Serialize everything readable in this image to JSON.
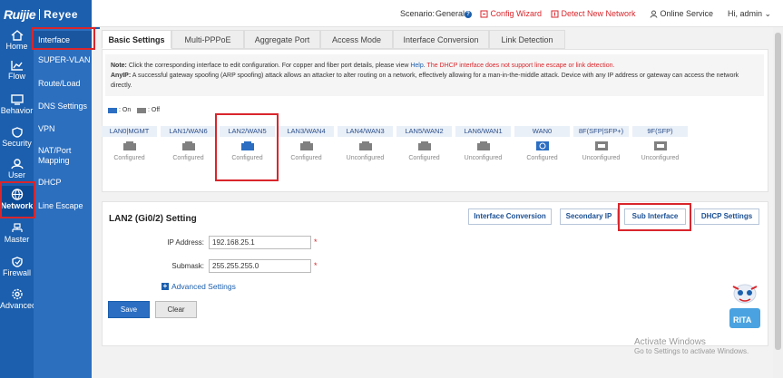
{
  "brand": {
    "logo_part1": "Ruijie",
    "logo_part2": "Reyee"
  },
  "leftnav": [
    {
      "label": "Home",
      "icon": "home-icon"
    },
    {
      "label": "Flow",
      "icon": "chart-icon"
    },
    {
      "label": "Behavior",
      "icon": "monitor-icon"
    },
    {
      "label": "Security",
      "icon": "shield-icon"
    },
    {
      "label": "User",
      "icon": "user-icon"
    },
    {
      "label": "Network",
      "icon": "globe-icon",
      "active": true
    },
    {
      "label": "Master",
      "icon": "master-icon"
    },
    {
      "label": "Firewall",
      "icon": "firewall-icon"
    },
    {
      "label": "Advanced",
      "icon": "gear-icon"
    }
  ],
  "submenu": [
    "Interface",
    "SUPER-VLAN",
    "Route/Load",
    "DNS Settings",
    "VPN",
    "NAT/Port Mapping",
    "DHCP",
    "Line Escape"
  ],
  "topbar": {
    "scenario_label": "Scenario:",
    "scenario_value": "General",
    "help_glyph": "?",
    "config_wizard": "Config Wizard",
    "detect_network": "Detect New Network",
    "online_service": "Online Service",
    "greeting": "Hi, admin",
    "greeting_caret": "⌄"
  },
  "tabs": [
    "Basic Settings",
    "Multi-PPPoE",
    "Aggregate Port",
    "Access Mode",
    "Interface Conversion",
    "Link Detection"
  ],
  "note": {
    "note_label": "Note:",
    "note_text": "Click the corresponding interface to edit configuration. For copper and fiber port details, please view",
    "help_link": "Help",
    "note_end": ".",
    "note_red": "The DHCP interface does not support line escape or link detection.",
    "anyip_label": "AnyIP:",
    "anyip_text": "A successful gateway spoofing (ARP spoofing) attack allows an attacker to alter routing on a network, effectively allowing for a man-in-the-middle attack. Device with any IP address or gateway can access the network directly."
  },
  "legend": {
    "on": ": On",
    "off": ": Off"
  },
  "ports": [
    {
      "name": "LAN0|MGMT",
      "status": "Configured",
      "on": false
    },
    {
      "name": "LAN1/WAN6",
      "status": "Configured",
      "on": false
    },
    {
      "name": "LAN2/WAN5",
      "status": "Configured",
      "on": true
    },
    {
      "name": "LAN3/WAN4",
      "status": "Configured",
      "on": false
    },
    {
      "name": "LAN4/WAN3",
      "status": "Unconfigured",
      "on": false
    },
    {
      "name": "LAN5/WAN2",
      "status": "Configured",
      "on": false
    },
    {
      "name": "LAN6/WAN1",
      "status": "Unconfigured",
      "on": false
    },
    {
      "name": "WAN0",
      "status": "Configured",
      "on": true
    },
    {
      "name": "8F(SFP|SFP+)",
      "status": "Unconfigured",
      "on": false
    },
    {
      "name": "9F(SFP)",
      "status": "Unconfigured",
      "on": false
    }
  ],
  "setting": {
    "title": "LAN2 (Gi0/2) Setting",
    "btn_interface_conversion": "Interface Conversion",
    "btn_secondary_ip": "Secondary IP",
    "btn_sub_interface": "Sub Interface",
    "btn_dhcp_settings": "DHCP Settings",
    "ip_label": "IP Address:",
    "ip_value": "192.168.25.1",
    "mask_label": "Submask:",
    "mask_value": "255.255.255.0",
    "required_mark": "*",
    "advanced": "Advanced Settings",
    "advanced_glyph": "+",
    "save": "Save",
    "clear": "Clear"
  },
  "watermark": {
    "line1": "Activate Windows",
    "line2": "Go to Settings to activate Windows."
  },
  "rita": "RITA",
  "colors": {
    "primary": "#1b5fae",
    "accent_red": "#d9262c",
    "port_on": "#2b6ec2",
    "port_off": "#808080"
  }
}
